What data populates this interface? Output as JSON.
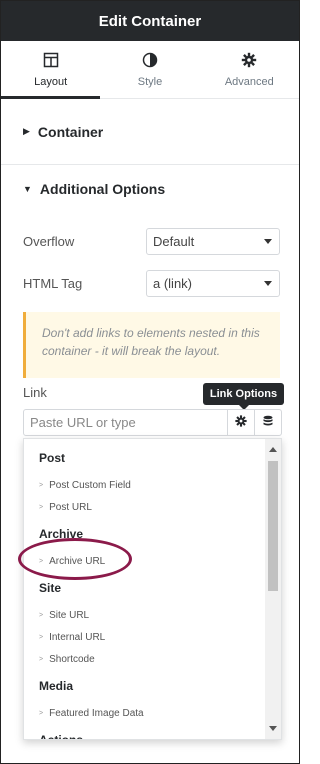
{
  "header": {
    "title": "Edit Container"
  },
  "tabs": [
    {
      "label": "Layout",
      "icon": "layout-icon",
      "active": true
    },
    {
      "label": "Style",
      "icon": "half-circle-icon",
      "active": false
    },
    {
      "label": "Advanced",
      "icon": "gear-icon",
      "active": false
    }
  ],
  "sections": {
    "container": {
      "title": "Container"
    },
    "additional": {
      "title": "Additional Options"
    }
  },
  "controls": {
    "overflow": {
      "label": "Overflow",
      "value": "Default"
    },
    "html_tag": {
      "label": "HTML Tag",
      "value": "a (link)"
    },
    "notice": "Don't add links to elements nested in this container - it will break the layout.",
    "link": {
      "label": "Link",
      "placeholder": "Paste URL or type",
      "tooltip": "Link Options"
    }
  },
  "dropdown": {
    "groups": [
      {
        "title": "Post",
        "items": [
          "Post Custom Field",
          "Post URL"
        ]
      },
      {
        "title": "Archive",
        "items": [
          "Archive URL"
        ]
      },
      {
        "title": "Site",
        "items": [
          "Site URL",
          "Internal URL",
          "Shortcode"
        ]
      },
      {
        "title": "Media",
        "items": [
          "Featured Image Data"
        ]
      },
      {
        "title": "Actions",
        "items": []
      }
    ]
  },
  "colors": {
    "header_bg": "#26292c",
    "notice_border": "#f0ad3c",
    "notice_bg": "#fff9e6",
    "highlight": "#8b1a4a"
  }
}
